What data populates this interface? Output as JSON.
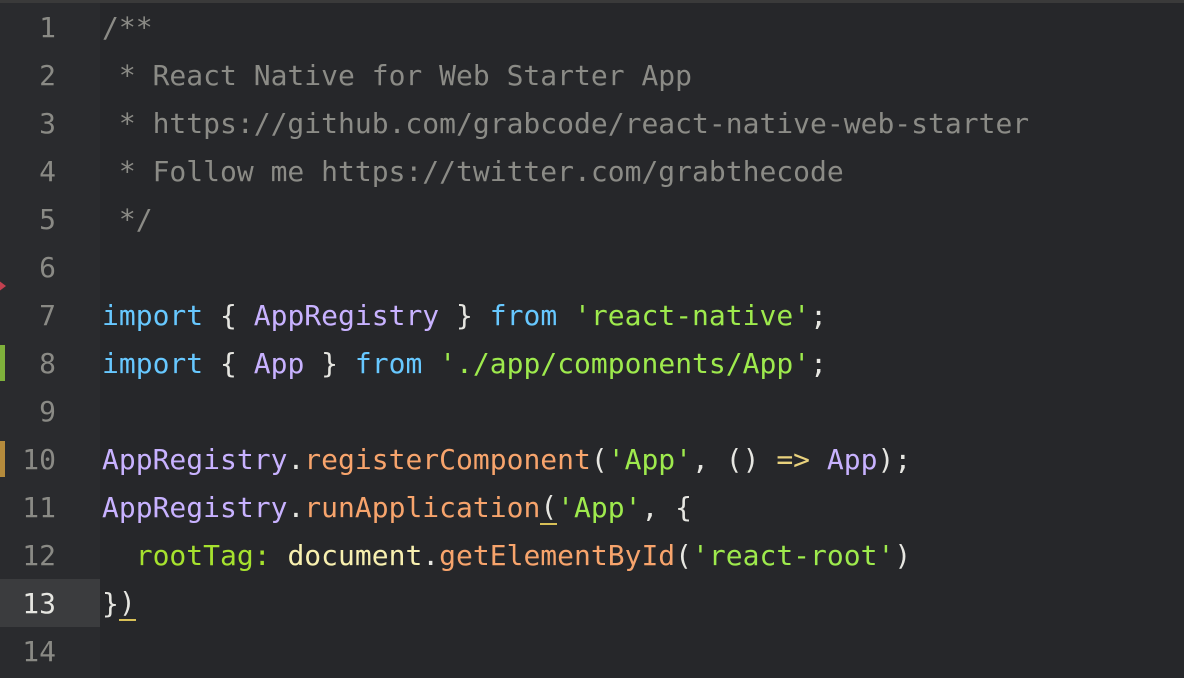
{
  "editor": {
    "active_line": 13,
    "colors": {
      "background": "#26272a",
      "gutter": "#2a2b2e",
      "comment": "#8b8b86",
      "keyword": "#67c8ff",
      "identifier": "#c8b2ff",
      "string": "#9eea4d",
      "method": "#f7a46c",
      "added_marker": "#7fb13b",
      "modified_marker": "#b58b3c",
      "deleted_marker": "#c2404f"
    },
    "line_numbers": [
      "1",
      "2",
      "3",
      "4",
      "5",
      "6",
      "7",
      "8",
      "9",
      "10",
      "11",
      "12",
      "13",
      "14"
    ],
    "lines": [
      {
        "tokens": [
          {
            "t": "/**",
            "k": "comment"
          }
        ]
      },
      {
        "tokens": [
          {
            "t": " * React Native for Web Starter App",
            "k": "comment"
          }
        ]
      },
      {
        "tokens": [
          {
            "t": " * https://github.com/grabcode/react-native-web-starter",
            "k": "comment"
          }
        ]
      },
      {
        "tokens": [
          {
            "t": " * Follow me https://twitter.com/grabthecode",
            "k": "comment"
          }
        ]
      },
      {
        "tokens": [
          {
            "t": " */",
            "k": "comment"
          }
        ]
      },
      {
        "tokens": []
      },
      {
        "tokens": [
          {
            "t": "import",
            "k": "keyword"
          },
          {
            "t": " { ",
            "k": "punc"
          },
          {
            "t": "AppRegistry",
            "k": "ident"
          },
          {
            "t": " } ",
            "k": "punc"
          },
          {
            "t": "from",
            "k": "keyword"
          },
          {
            "t": " ",
            "k": "punc"
          },
          {
            "t": "'react-native'",
            "k": "string"
          },
          {
            "t": ";",
            "k": "punc"
          }
        ]
      },
      {
        "tokens": [
          {
            "t": "import",
            "k": "keyword"
          },
          {
            "t": " { ",
            "k": "punc"
          },
          {
            "t": "App",
            "k": "ident"
          },
          {
            "t": " } ",
            "k": "punc"
          },
          {
            "t": "from",
            "k": "keyword"
          },
          {
            "t": " ",
            "k": "punc"
          },
          {
            "t": "'./app/components/App'",
            "k": "string"
          },
          {
            "t": ";",
            "k": "punc"
          }
        ]
      },
      {
        "tokens": []
      },
      {
        "tokens": [
          {
            "t": "AppRegistry",
            "k": "ident"
          },
          {
            "t": ".",
            "k": "punc"
          },
          {
            "t": "registerComponent",
            "k": "method"
          },
          {
            "t": "(",
            "k": "punc"
          },
          {
            "t": "'App'",
            "k": "string"
          },
          {
            "t": ", () ",
            "k": "punc"
          },
          {
            "t": "=>",
            "k": "arrow"
          },
          {
            "t": " ",
            "k": "punc"
          },
          {
            "t": "App",
            "k": "ident"
          },
          {
            "t": ");",
            "k": "punc"
          }
        ]
      },
      {
        "tokens": [
          {
            "t": "AppRegistry",
            "k": "ident"
          },
          {
            "t": ".",
            "k": "punc"
          },
          {
            "t": "runApplication",
            "k": "method"
          },
          {
            "t": "(",
            "k": "punc",
            "match": true
          },
          {
            "t": "'App'",
            "k": "string"
          },
          {
            "t": ", {",
            "k": "punc"
          }
        ]
      },
      {
        "tokens": [
          {
            "t": "  ",
            "k": "punc"
          },
          {
            "t": "rootTag:",
            "k": "prop"
          },
          {
            "t": " ",
            "k": "punc"
          },
          {
            "t": "document",
            "k": "global"
          },
          {
            "t": ".",
            "k": "punc"
          },
          {
            "t": "getElementById",
            "k": "method"
          },
          {
            "t": "(",
            "k": "punc"
          },
          {
            "t": "'react-root'",
            "k": "string"
          },
          {
            "t": ")",
            "k": "punc"
          }
        ]
      },
      {
        "tokens": [
          {
            "t": "}",
            "k": "punc"
          },
          {
            "t": ")",
            "k": "punc",
            "match": true
          }
        ]
      },
      {
        "tokens": []
      }
    ],
    "git_markers": {
      "7": "deleted",
      "8": "added",
      "10": "modified"
    }
  }
}
